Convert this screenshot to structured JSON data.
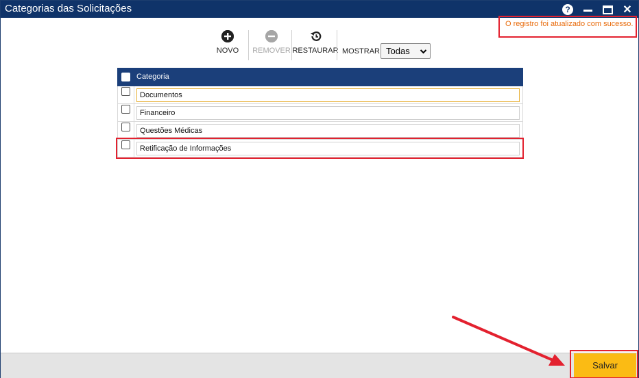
{
  "window": {
    "title": "Categorias das Solicitações",
    "controls": {
      "help": "?",
      "close": "✕"
    }
  },
  "notice": {
    "text": "O registro foi atualizado com sucesso."
  },
  "toolbar": {
    "novo": "NOVO",
    "remover": "REMOVER",
    "restaurar": "RESTAURAR",
    "mostrar_label": "MOSTRAR:",
    "mostrar_value": "Todas"
  },
  "grid": {
    "header": "Categoria",
    "rows": [
      {
        "value": "Documentos"
      },
      {
        "value": "Financeiro"
      },
      {
        "value": "Questões Médicas"
      },
      {
        "value": "Retificação de Informações"
      }
    ]
  },
  "footer": {
    "save_label": "Salvar"
  },
  "colors": {
    "titlebar": "#0f3369",
    "grid_header": "#1b3f7a",
    "save_button": "#fbbb14",
    "annotation": "#e3212f",
    "notice_text": "#e86a0a"
  },
  "icons": {
    "novo": "plus-circle-icon",
    "remover": "minus-circle-icon",
    "restaurar": "restore-icon"
  }
}
